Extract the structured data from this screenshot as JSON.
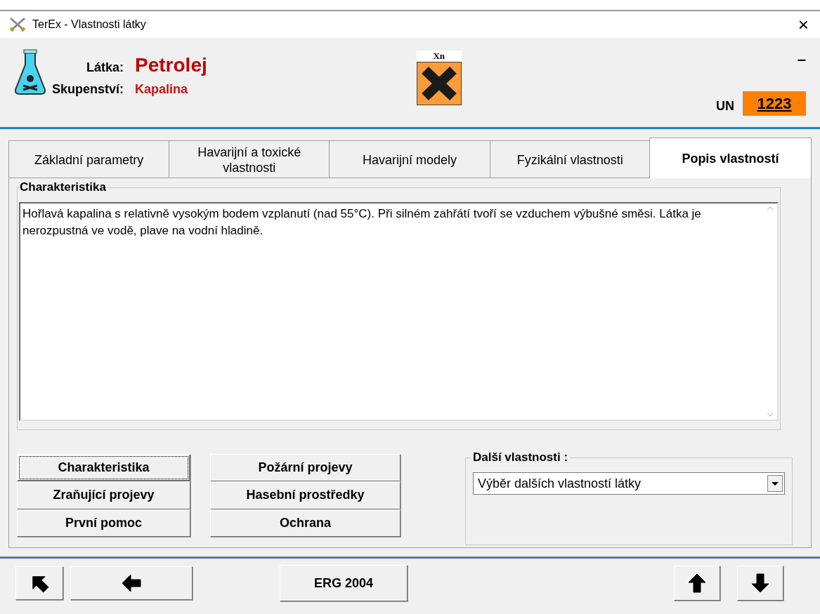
{
  "window": {
    "title": "TerEx - Vlastnosti látky",
    "close": "×"
  },
  "header": {
    "substance_label": "Látka:",
    "substance": "Petrolej",
    "state_label": "Skupenství:",
    "state": "Kapalina",
    "hazard_symbol": "Xn",
    "minimize": "–",
    "un_label": "UN",
    "un_number": "1223"
  },
  "tabs": [
    {
      "label": "Základní parametry",
      "selected": false
    },
    {
      "label": "Havarijní a toxické vlastnosti",
      "selected": false
    },
    {
      "label": "Havarijní modely",
      "selected": false
    },
    {
      "label": "Fyzikální vlastnosti",
      "selected": false
    },
    {
      "label": "Popis vlastností",
      "selected": true
    }
  ],
  "characteristics": {
    "title": "Charakteristika",
    "text": "Hořlavá kapalina s relativně vysokým bodem vzplanutí (nad 55°C). Při silném zahřátí tvoří se vzduchem výbušné směsi. Látka je nerozpustná ve vodě, plave na vodní hladině."
  },
  "section_buttons": [
    {
      "label": "Charakteristika",
      "selected": true
    },
    {
      "label": "Zraňující projevy",
      "selected": false
    },
    {
      "label": "První pomoc",
      "selected": false
    },
    {
      "label": "Požární projevy",
      "selected": false
    },
    {
      "label": "Hasební prostředky",
      "selected": false
    },
    {
      "label": "Ochrana",
      "selected": false
    }
  ],
  "more_properties": {
    "title": "Další vlastnosti :",
    "value": "Výběr dalších vlastností látky"
  },
  "footer": {
    "erg_button": "ERG 2004"
  }
}
